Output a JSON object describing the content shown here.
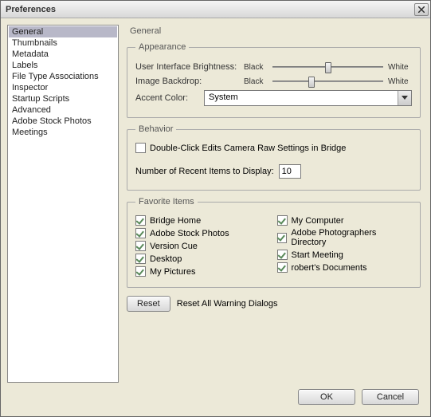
{
  "window": {
    "title": "Preferences"
  },
  "sidebar": {
    "items": [
      "General",
      "Thumbnails",
      "Metadata",
      "Labels",
      "File Type Associations",
      "Inspector",
      "Startup Scripts",
      "Advanced",
      "Adobe Stock Photos",
      "Meetings"
    ],
    "selected_index": 0
  },
  "main": {
    "heading": "General",
    "appearance": {
      "legend": "Appearance",
      "brightness_label": "User Interface Brightness:",
      "backdrop_label": "Image Backdrop:",
      "slider_left": "Black",
      "slider_right": "White",
      "brightness_value_pct": 50,
      "backdrop_value_pct": 35,
      "accent_label": "Accent Color:",
      "accent_value": "System"
    },
    "behavior": {
      "legend": "Behavior",
      "dblclick_label": "Double-Click Edits Camera Raw Settings in Bridge",
      "dblclick_checked": false,
      "recent_label": "Number of Recent Items to Display:",
      "recent_value": "10"
    },
    "favorites": {
      "legend": "Favorite Items",
      "left": [
        {
          "label": "Bridge Home",
          "checked": true
        },
        {
          "label": "Adobe Stock Photos",
          "checked": true
        },
        {
          "label": "Version Cue",
          "checked": true
        },
        {
          "label": "Desktop",
          "checked": true
        },
        {
          "label": "My Pictures",
          "checked": true
        }
      ],
      "right": [
        {
          "label": "My Computer",
          "checked": true
        },
        {
          "label": "Adobe Photographers Directory",
          "checked": true
        },
        {
          "label": "Start Meeting",
          "checked": true
        },
        {
          "label": "robert's Documents",
          "checked": true
        }
      ]
    },
    "reset_button": "Reset",
    "reset_warnings_label": "Reset All Warning Dialogs"
  },
  "footer": {
    "ok": "OK",
    "cancel": "Cancel"
  }
}
